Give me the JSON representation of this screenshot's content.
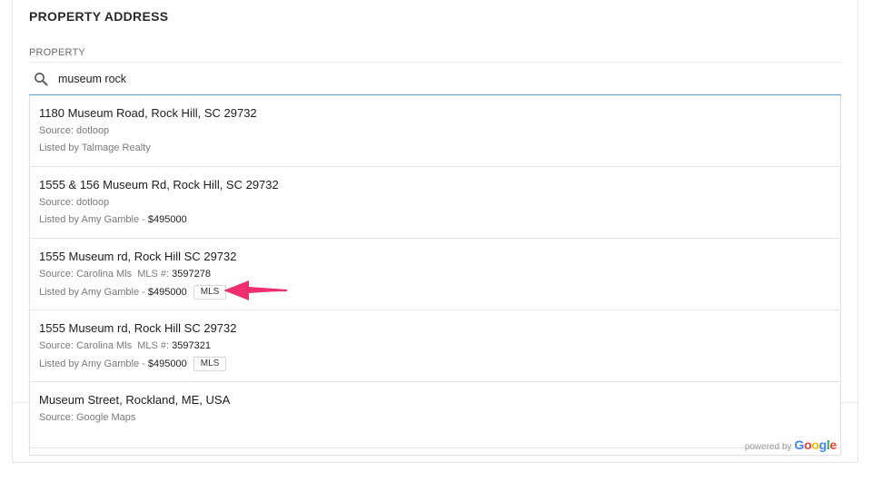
{
  "section": {
    "title": "PROPERTY ADDRESS"
  },
  "field": {
    "label": "PROPERTY"
  },
  "search": {
    "value": "museum rock",
    "icon": "search-icon"
  },
  "suggestions": [
    {
      "address": "1180 Museum Road, Rock Hill, SC 29732",
      "source_label": "Source:",
      "source": "dotloop",
      "listed_label": "Listed by",
      "agent": "Talmage Realty"
    },
    {
      "address": "1555 & 156 Museum Rd, Rock Hill, SC 29732",
      "source_label": "Source:",
      "source": "dotloop",
      "listed_label": "Listed by",
      "agent": "Amy Gamble",
      "sep": "-",
      "price": "$495000"
    },
    {
      "address": "1555 Museum rd, Rock Hill SC 29732",
      "source_label": "Source:",
      "source": "Carolina Mls",
      "mls_label": "MLS #:",
      "mls_number": "3597278",
      "listed_label": "Listed by",
      "agent": "Amy Gamble",
      "sep": "-",
      "price": "$495000",
      "badge": "MLS"
    },
    {
      "address": "1555 Museum rd, Rock Hill SC 29732",
      "source_label": "Source:",
      "source": "Carolina Mls",
      "mls_label": "MLS #:",
      "mls_number": "3597321",
      "listed_label": "Listed by",
      "agent": "Amy Gamble",
      "sep": "-",
      "price": "$495000",
      "badge": "MLS"
    },
    {
      "address": "Museum Street, Rockland, ME, USA",
      "source_label": "Source:",
      "source": "Google Maps"
    }
  ],
  "attribution": {
    "prefix": "powered by",
    "brand": "Google"
  },
  "colors": {
    "accent_underline": "#5b9bd5",
    "arrow": "#f0306e"
  }
}
